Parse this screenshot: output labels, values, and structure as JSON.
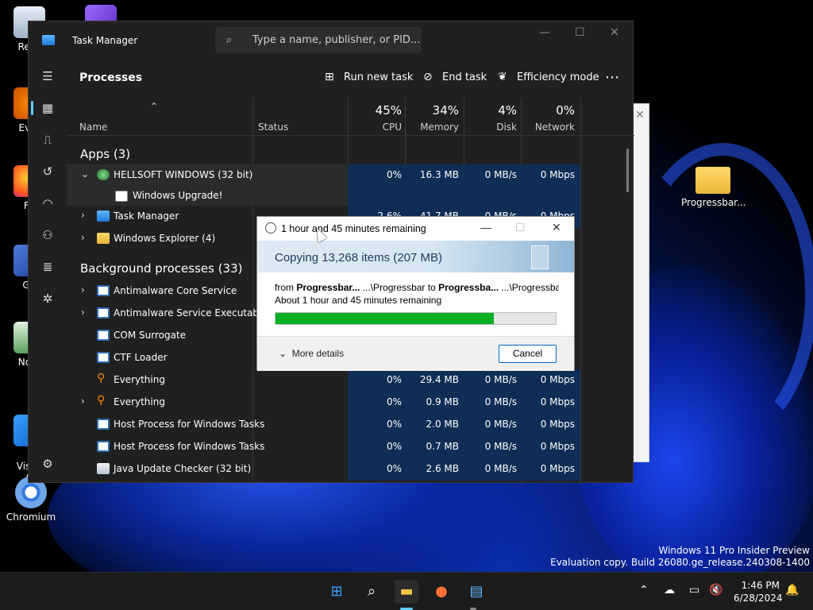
{
  "desktop": {
    "icons": [
      {
        "label": "Recy"
      },
      {
        "label": "Ever"
      },
      {
        "label": "Fir"
      },
      {
        "label": "Git"
      },
      {
        "label": "Note"
      },
      {
        "label": "Visua\nC"
      },
      {
        "label": "Chromium"
      }
    ],
    "folder": {
      "label": "Progressbar..."
    }
  },
  "task_manager": {
    "title": "Task Manager",
    "search_placeholder": "Type a name, publisher, or PID...",
    "page_title": "Processes",
    "actions": {
      "run_new_task": "Run new task",
      "end_task": "End task",
      "efficiency_mode": "Efficiency mode"
    },
    "columns": {
      "name": "Name",
      "status": "Status",
      "cpu": {
        "pct": "45%",
        "label": "CPU"
      },
      "memory": {
        "pct": "34%",
        "label": "Memory"
      },
      "disk": {
        "pct": "4%",
        "label": "Disk"
      },
      "network": {
        "pct": "0%",
        "label": "Network"
      }
    },
    "groups": {
      "apps": "Apps (3)",
      "background": "Background processes (33)"
    },
    "rows": [
      {
        "name": "HELLSOFT WINDOWS (32 bit)",
        "cpu": "0%",
        "memory": "16.3 MB",
        "disk": "0 MB/s",
        "network": "0 Mbps"
      },
      {
        "name": "Windows Upgrade!",
        "cpu": "",
        "memory": "",
        "disk": "",
        "network": ""
      },
      {
        "name": "Task Manager",
        "cpu": "2.6%",
        "memory": "41.7 MB",
        "disk": "0 MB/s",
        "network": "0 Mbps"
      },
      {
        "name": "Windows Explorer (4)",
        "cpu": "",
        "memory": "",
        "disk": "",
        "network": ""
      },
      {
        "name": "Antimalware Core Service",
        "cpu": "",
        "memory": "",
        "disk": "",
        "network": ""
      },
      {
        "name": "Antimalware Service Executable",
        "cpu": "",
        "memory": "",
        "disk": "",
        "network": ""
      },
      {
        "name": "COM Surrogate",
        "cpu": "",
        "memory": "",
        "disk": "",
        "network": ""
      },
      {
        "name": "CTF Loader",
        "cpu": "",
        "memory": "",
        "disk": "",
        "network": ""
      },
      {
        "name": "Everything",
        "cpu": "0%",
        "memory": "29.4 MB",
        "disk": "0 MB/s",
        "network": "0 Mbps"
      },
      {
        "name": "Everything",
        "cpu": "0%",
        "memory": "0.9 MB",
        "disk": "0 MB/s",
        "network": "0 Mbps"
      },
      {
        "name": "Host Process for Windows Tasks",
        "cpu": "0%",
        "memory": "2.0 MB",
        "disk": "0 MB/s",
        "network": "0 Mbps"
      },
      {
        "name": "Host Process for Windows Tasks",
        "cpu": "0%",
        "memory": "0.7 MB",
        "disk": "0 MB/s",
        "network": "0 Mbps"
      },
      {
        "name": "Java Update Checker (32 bit)",
        "cpu": "0%",
        "memory": "2.6 MB",
        "disk": "0 MB/s",
        "network": "0 Mbps"
      }
    ]
  },
  "copy_dialog": {
    "title": "1 hour and 45 minutes remaining",
    "heading": "Copying 13,268 items (207 MB)",
    "from_prefix": "from ",
    "from_name": "Progressbar...",
    "from_path": " ...\\Progressbar to ",
    "to_name": "Progressba...",
    "to_path": " ...\\Progressbar",
    "remaining": "About 1 hour and 45 minutes remaining",
    "progress_percent": 78,
    "more_details": "More details",
    "cancel": "Cancel"
  },
  "watermark": {
    "line1": "Windows 11 Pro Insider Preview",
    "line2": "Evaluation copy. Build 26080.ge_release.240308-1400"
  },
  "taskbar": {
    "time": "1:46 PM",
    "date": "6/28/2024"
  }
}
